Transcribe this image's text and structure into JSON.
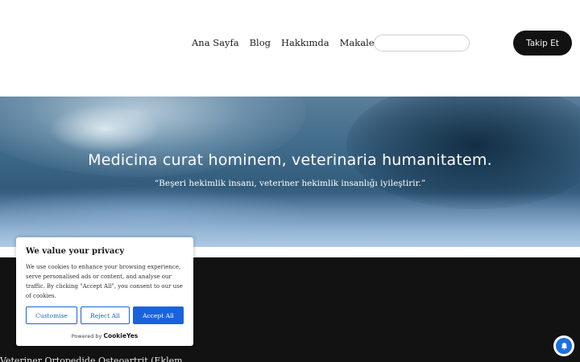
{
  "nav": {
    "items": [
      {
        "label": "Ana Sayfa"
      },
      {
        "label": "Blog"
      },
      {
        "label": "Hakkımda"
      },
      {
        "label": "Makaleler"
      }
    ],
    "follow_label": "Takip Et",
    "search_value": ""
  },
  "hero": {
    "title": "Medicina curat hominem, veterinaria humanitatem.",
    "subtitle": "“Beşeri hekimlik insanı, veteriner hekimlik insanlığı iyileştirir.”"
  },
  "post": {
    "title": "Veteriner Ortopedide Osteoartrit (Eklem"
  },
  "cookie": {
    "title": "We value your privacy",
    "text": "We use cookies to enhance your browsing experience, serve personalised ads or content, and analyse our traffic. By clicking \"Accept All\", you consent to our use of cookies.",
    "customise": "Customise",
    "reject": "Reject All",
    "accept": "Accept All",
    "powered_by": "Powered by",
    "brand": "CookieYes"
  },
  "colors": {
    "accent": "#1863dc",
    "follow_button": "#121212",
    "dark_section": "#121212",
    "bell": "#1a6fe0"
  },
  "icons": {
    "dropdown": "chevron-down-icon",
    "notification": "bell-icon"
  }
}
